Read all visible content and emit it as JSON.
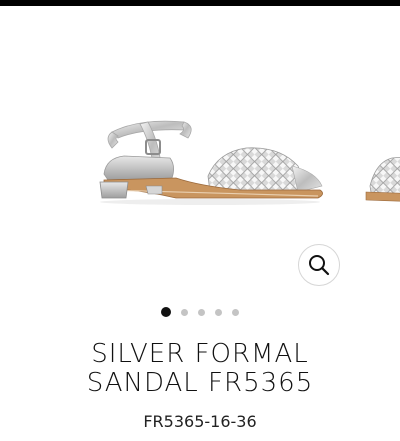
{
  "gallery": {
    "slide_count": 5,
    "active_slide": 1,
    "zoom_icon": "search-icon"
  },
  "product": {
    "title_line1": "SILVER FORMAL",
    "title_line2": "SANDAL FR5365",
    "sku": "FR5365-16-36"
  },
  "colors": {
    "top_bar": "#000000",
    "text": "#111111",
    "dot_active": "#111111",
    "dot_inactive": "#c4c4c4",
    "zoom_border": "#d6d6d6"
  }
}
